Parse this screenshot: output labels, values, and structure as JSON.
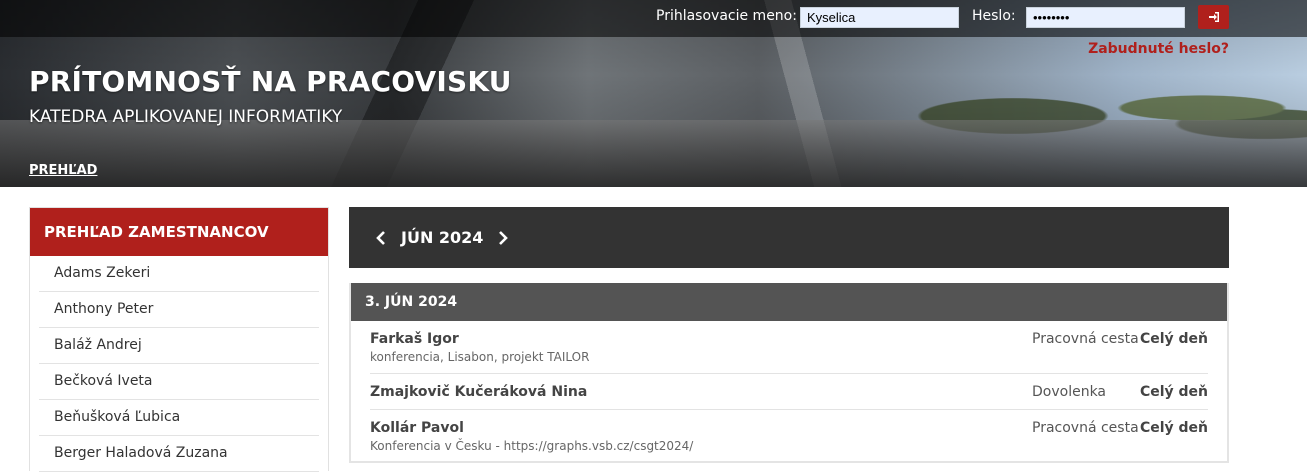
{
  "login": {
    "username_label": "Prihlasovacie meno:",
    "username_value": "Kyselica",
    "password_label": "Heslo:",
    "password_value": "••••••••",
    "submit_icon": "sign-in-icon",
    "forgot_label": "Zabudnuté heslo?"
  },
  "header": {
    "title": "PRÍTOMNOSŤ NA PRACOVISKU",
    "subtitle": "KATEDRA APLIKOVANEJ INFORMATIKY",
    "nav_link": "PREHĽAD"
  },
  "sidebar": {
    "heading": "PREHĽAD ZAMESTNANCOV",
    "items": [
      {
        "label": "Adams Zekeri"
      },
      {
        "label": "Anthony Peter"
      },
      {
        "label": "Baláž Andrej"
      },
      {
        "label": "Bečková Iveta"
      },
      {
        "label": "Beňušková Ľubica"
      },
      {
        "label": "Berger Haladová Zuzana"
      }
    ]
  },
  "calendar": {
    "month_label": "JÚN 2024",
    "prev_icon": "chevron-left-icon",
    "next_icon": "chevron-right-icon",
    "day": {
      "heading": "3. JÚN 2024",
      "entries": [
        {
          "name": "Farkaš Igor",
          "note": "konferencia, Lisabon, projekt TAILOR",
          "type": "Pracovná cesta",
          "duration": "Celý deň"
        },
        {
          "name": "Zmajkovič Kučeráková Nina",
          "note": "",
          "type": "Dovolenka",
          "duration": "Celý deň"
        },
        {
          "name": "Kollár Pavol",
          "note": "Konferencia v Česku - https://graphs.vsb.cz/csgt2024/",
          "type": "Pracovná cesta",
          "duration": "Celý deň"
        }
      ]
    }
  },
  "colors": {
    "accent_red": "#b0201c",
    "month_bar": "#333333",
    "day_header": "#545454"
  }
}
